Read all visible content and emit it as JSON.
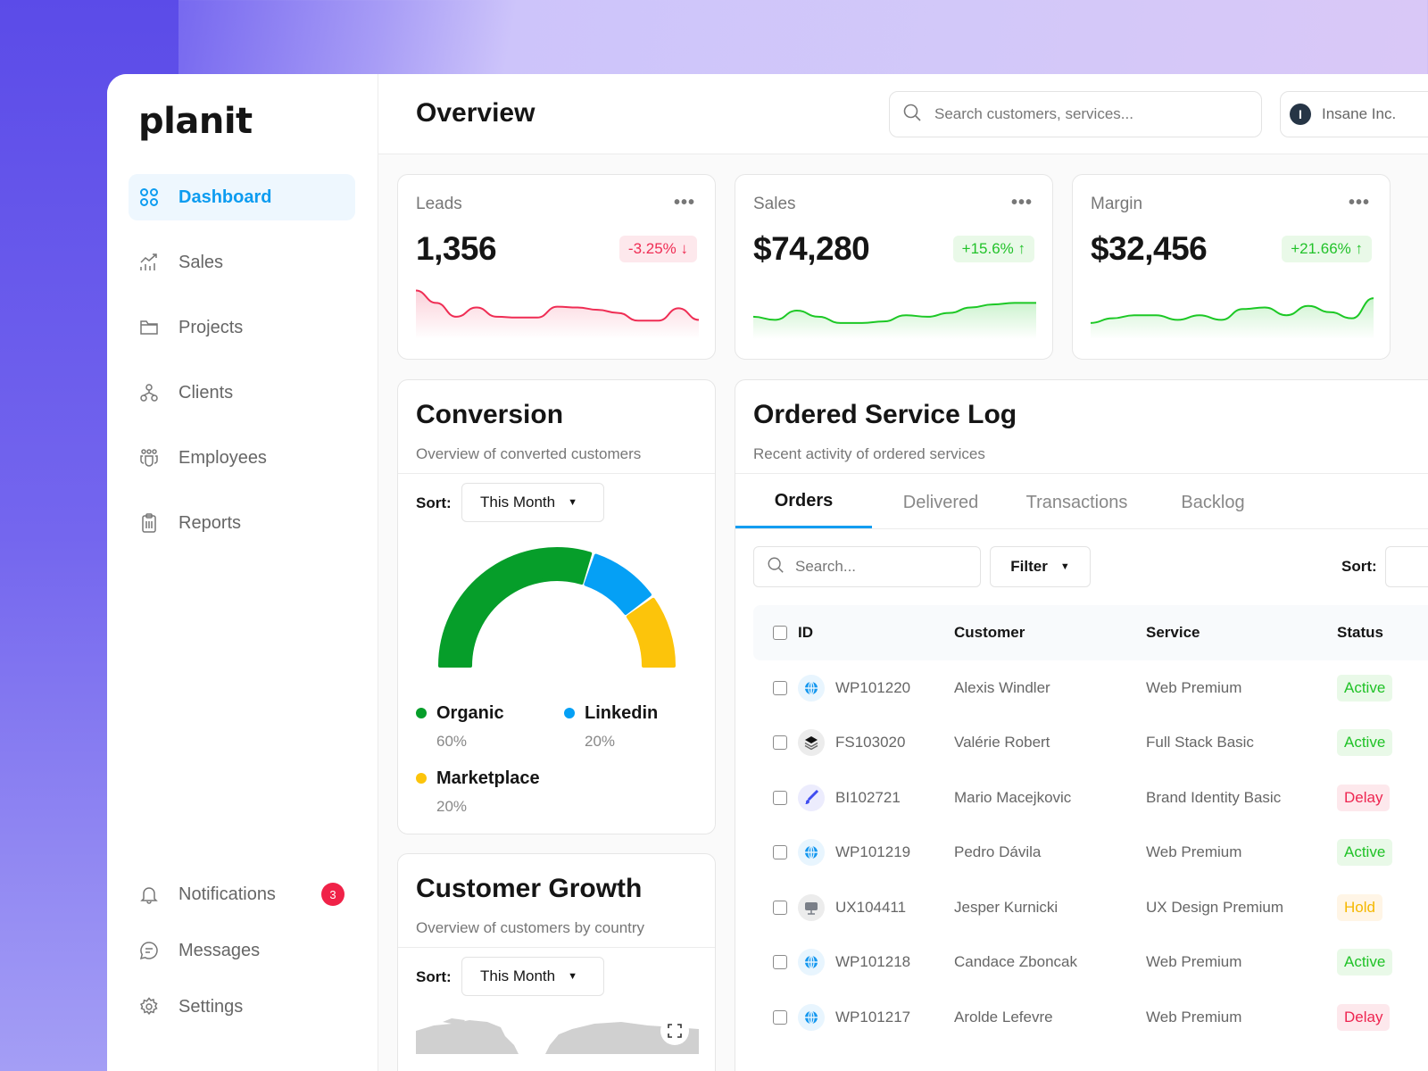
{
  "brand": {
    "logo": "planit"
  },
  "sidebar": {
    "items": [
      {
        "label": "Dashboard",
        "icon": "grid-icon",
        "active": true
      },
      {
        "label": "Sales",
        "icon": "chart-growth-icon"
      },
      {
        "label": "Projects",
        "icon": "folder-icon"
      },
      {
        "label": "Clients",
        "icon": "hierarchy-icon"
      },
      {
        "label": "Employees",
        "icon": "team-icon"
      },
      {
        "label": "Reports",
        "icon": "clipboard-icon"
      }
    ],
    "bottom": [
      {
        "label": "Notifications",
        "icon": "bell-icon",
        "badge": "3"
      },
      {
        "label": "Messages",
        "icon": "chat-icon"
      },
      {
        "label": "Settings",
        "icon": "gear-icon"
      }
    ]
  },
  "header": {
    "title": "Overview",
    "search_placeholder": "Search customers, services...",
    "org_name": "Insane Inc.",
    "org_initial": "I"
  },
  "stats": [
    {
      "label": "Leads",
      "value": "1,356",
      "delta": "-3.25% ↓",
      "direction": "down",
      "color": "#ef2d54",
      "trend": [
        56,
        40,
        22,
        34,
        22,
        21,
        21,
        35,
        34,
        31,
        27,
        17,
        17,
        33,
        18
      ]
    },
    {
      "label": "Sales",
      "value": "$74,280",
      "delta": "+15.6% ↑",
      "direction": "up",
      "color": "#1cc825",
      "trend": [
        22,
        18,
        30,
        22,
        14,
        14,
        16,
        24,
        22,
        27,
        34,
        38,
        40,
        40
      ]
    },
    {
      "label": "Margin",
      "value": "$32,456",
      "delta": "+21.66% ↑",
      "direction": "up",
      "color": "#1cc825",
      "trend": [
        14,
        20,
        24,
        24,
        18,
        24,
        18,
        32,
        34,
        24,
        36,
        28,
        20,
        46
      ]
    }
  ],
  "conversion": {
    "title": "Conversion",
    "subtitle": "Overview of converted customers",
    "sort_label": "Sort:",
    "sort_value": "This Month",
    "legend": [
      {
        "name": "Organic",
        "pct": "60%",
        "value": 60,
        "color": "#069e2a"
      },
      {
        "name": "Linkedin",
        "pct": "20%",
        "value": 20,
        "color": "#05a0f5"
      },
      {
        "name": "Marketplace",
        "pct": "20%",
        "value": 20,
        "color": "#fcc40b"
      }
    ]
  },
  "growth": {
    "title": "Customer Growth",
    "subtitle": "Overview of customers by country",
    "sort_label": "Sort:",
    "sort_value": "This Month"
  },
  "service_log": {
    "title": "Ordered Service Log",
    "subtitle": "Recent activity of ordered services",
    "tabs": [
      "Orders",
      "Delivered",
      "Transactions",
      "Backlog"
    ],
    "active_tab": 0,
    "search_placeholder": "Search...",
    "filter_label": "Filter",
    "sort_label": "Sort:",
    "columns": [
      "ID",
      "Customer",
      "Service",
      "Status"
    ],
    "rows": [
      {
        "id": "WP101220",
        "customer": "Alexis Windler",
        "service": "Web Premium",
        "status": "Active",
        "icon": "globe-icon"
      },
      {
        "id": "FS103020",
        "customer": "Valérie Robert",
        "service": "Full Stack Basic",
        "status": "Active",
        "icon": "layers-icon"
      },
      {
        "id": "BI102721",
        "customer": "Mario Macejkovic",
        "service": "Brand Identity Basic",
        "status": "Delay",
        "icon": "brush-icon"
      },
      {
        "id": "WP101219",
        "customer": "Pedro Dávila",
        "service": "Web Premium",
        "status": "Active",
        "icon": "globe-icon"
      },
      {
        "id": "UX104411",
        "customer": "Jesper Kurnicki",
        "service": "UX Design Premium",
        "status": "Hold",
        "icon": "monitor-icon"
      },
      {
        "id": "WP101218",
        "customer": "Candace Zboncak",
        "service": "Web Premium",
        "status": "Active",
        "icon": "globe-icon"
      },
      {
        "id": "WP101217",
        "customer": "Arolde Lefevre",
        "service": "Web Premium",
        "status": "Delay",
        "icon": "globe-icon"
      }
    ]
  }
}
